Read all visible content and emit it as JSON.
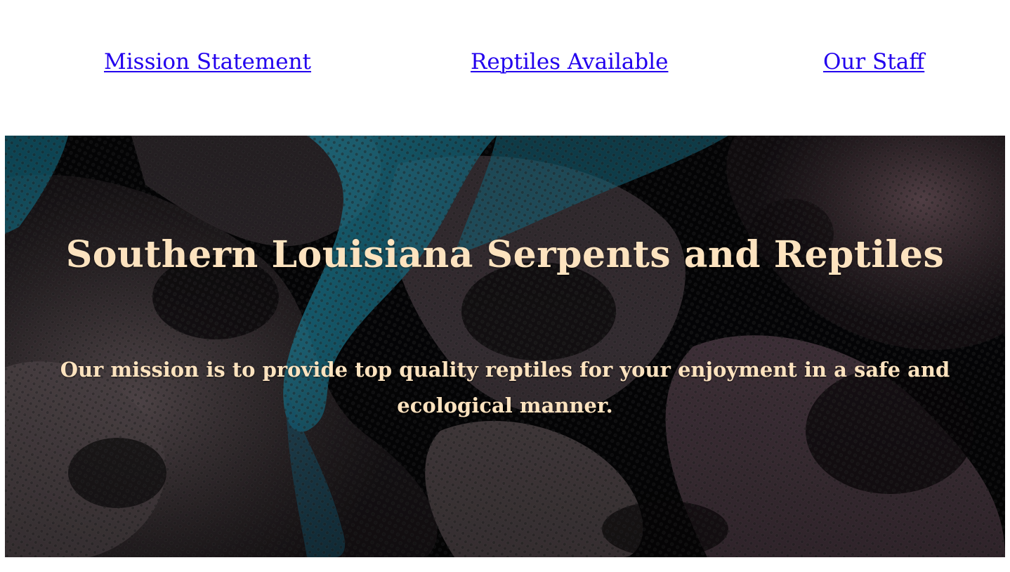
{
  "nav": {
    "links": [
      {
        "label": "Mission Statement"
      },
      {
        "label": "Reptiles Available"
      },
      {
        "label": "Our Staff"
      }
    ]
  },
  "hero": {
    "title": "Southern Louisiana Serpents and Reptiles",
    "mission_text": "Our mission is to provide top quality reptiles for your enjoyment in a safe and ecological manner.",
    "image": "snake-scales-background"
  },
  "colors": {
    "link": "#2200ee",
    "hero_text": "#fde3bf",
    "hero_dark": "#060608",
    "scale_teal": "#1f93b0",
    "scale_mauve": "#6f5560"
  }
}
